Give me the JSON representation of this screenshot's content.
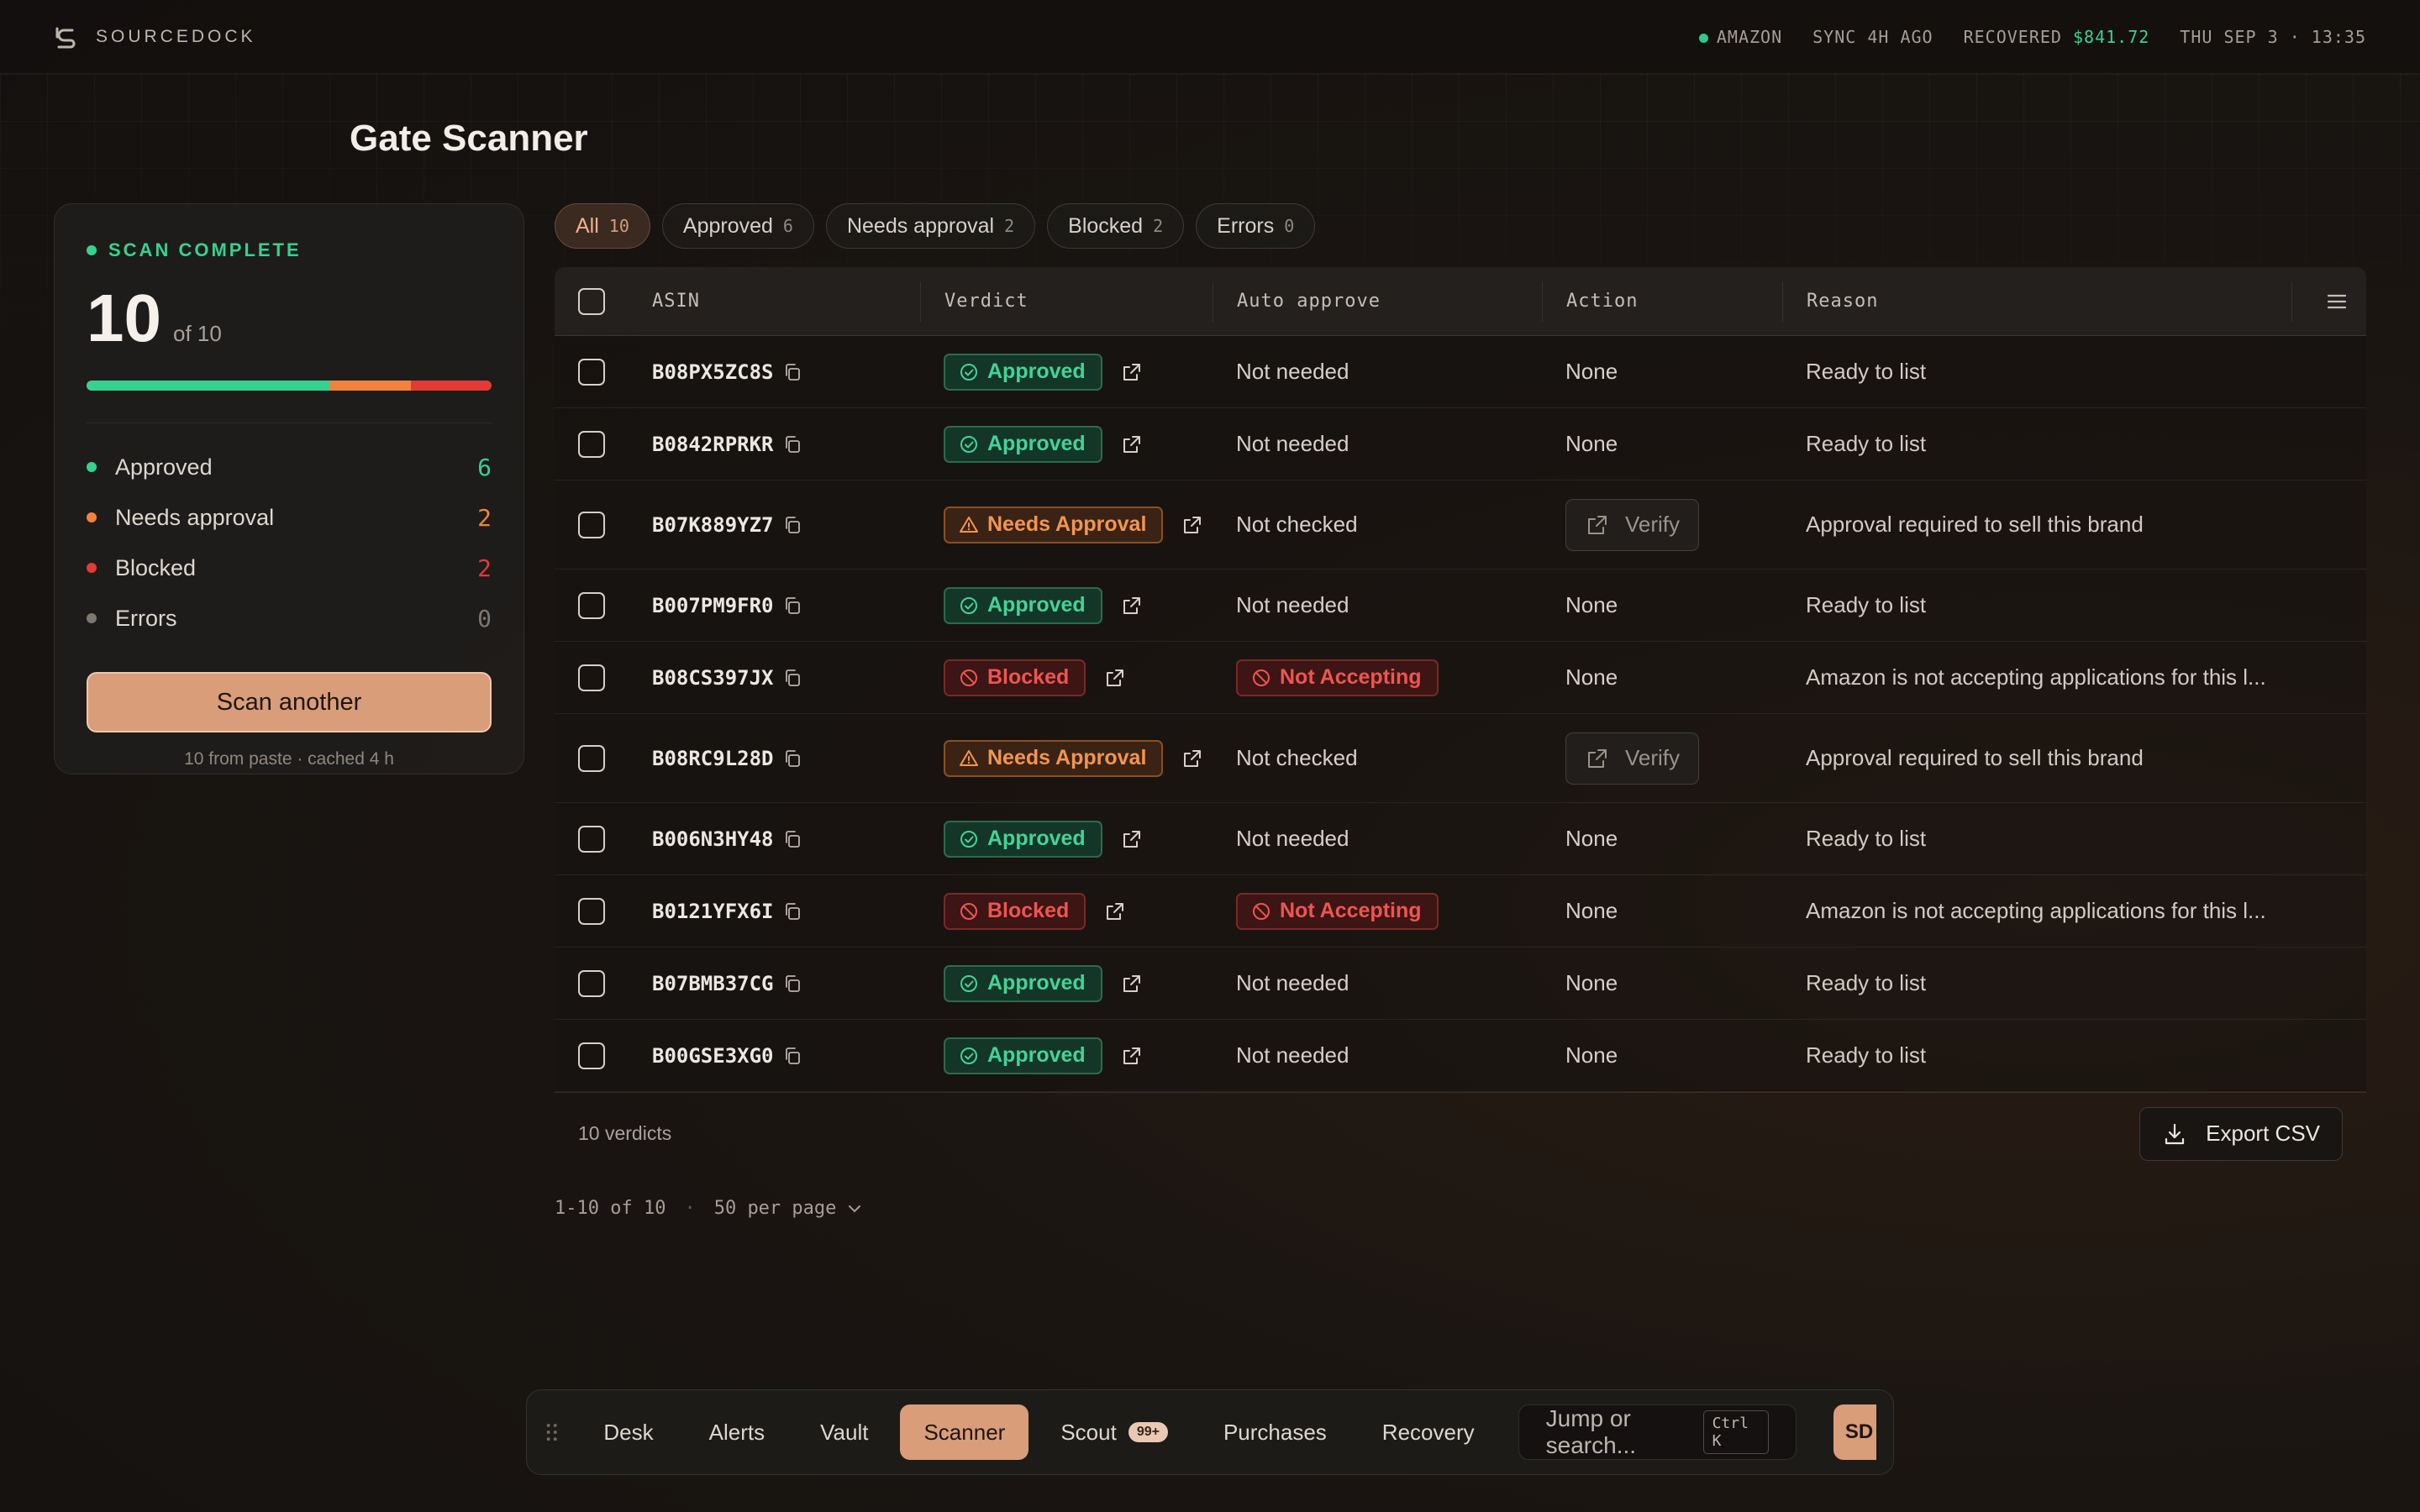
{
  "header": {
    "brand": "SOURCEDOCK",
    "marketplace": "AMAZON",
    "sync": "SYNC 4H AGO",
    "recovered_label": "RECOVERED",
    "recovered_value": "$841.72",
    "datetime": "THU SEP 3 · 13:35"
  },
  "page": {
    "title": "Gate Scanner"
  },
  "summary": {
    "status": "SCAN COMPLETE",
    "count": "10",
    "of_total": "of 10",
    "progress": {
      "approved": 6,
      "needs": 2,
      "blocked": 2,
      "errors": 0,
      "total": 10
    },
    "legend": [
      {
        "label": "Approved",
        "count": "6",
        "color": "#37d18f"
      },
      {
        "label": "Needs approval",
        "count": "2",
        "color": "#f2823e"
      },
      {
        "label": "Blocked",
        "count": "2",
        "color": "#e23b36"
      },
      {
        "label": "Errors",
        "count": "0",
        "color": "#7d7770"
      }
    ],
    "scan_button": "Scan another",
    "footnote": "10 from paste · cached 4 h"
  },
  "filters": [
    {
      "label": "All",
      "count": "10"
    },
    {
      "label": "Approved",
      "count": "6"
    },
    {
      "label": "Needs approval",
      "count": "2"
    },
    {
      "label": "Blocked",
      "count": "2"
    },
    {
      "label": "Errors",
      "count": "0"
    }
  ],
  "table": {
    "headers": {
      "asin": "ASIN",
      "verdict": "Verdict",
      "auto": "Auto approve",
      "action": "Action",
      "reason": "Reason"
    },
    "rows": [
      {
        "asin": "B08PX5ZC8S",
        "verdict": "Approved",
        "auto": "Not needed",
        "action": "None",
        "reason": "Ready to list"
      },
      {
        "asin": "B0842RPRKR",
        "verdict": "Approved",
        "auto": "Not needed",
        "action": "None",
        "reason": "Ready to list"
      },
      {
        "asin": "B07K889YZ7",
        "verdict": "Needs Approval",
        "auto": "Not checked",
        "action": "Verify",
        "reason": "Approval required to sell this brand"
      },
      {
        "asin": "B007PM9FR0",
        "verdict": "Approved",
        "auto": "Not needed",
        "action": "None",
        "reason": "Ready to list"
      },
      {
        "asin": "B08CS397JX",
        "verdict": "Blocked",
        "auto": "Not Accepting",
        "action": "None",
        "reason": "Amazon is not accepting applications for this l..."
      },
      {
        "asin": "B08RC9L28D",
        "verdict": "Needs Approval",
        "auto": "Not checked",
        "action": "Verify",
        "reason": "Approval required to sell this brand"
      },
      {
        "asin": "B006N3HY48",
        "verdict": "Approved",
        "auto": "Not needed",
        "action": "None",
        "reason": "Ready to list"
      },
      {
        "asin": "B0121YFX6I",
        "verdict": "Blocked",
        "auto": "Not Accepting",
        "action": "None",
        "reason": "Amazon is not accepting applications for this l..."
      },
      {
        "asin": "B07BMB37CG",
        "verdict": "Approved",
        "auto": "Not needed",
        "action": "None",
        "reason": "Ready to list"
      },
      {
        "asin": "B00GSE3XG0",
        "verdict": "Approved",
        "auto": "Not needed",
        "action": "None",
        "reason": "Ready to list"
      }
    ],
    "footer_count": "10 verdicts",
    "export_label": "Export CSV"
  },
  "pager": {
    "range": "1-10 of 10",
    "per_page": "50 per page"
  },
  "dock": {
    "items": [
      {
        "label": "Desk"
      },
      {
        "label": "Alerts"
      },
      {
        "label": "Vault"
      },
      {
        "label": "Scanner",
        "active": true
      },
      {
        "label": "Scout",
        "badge": "99+"
      },
      {
        "label": "Purchases"
      },
      {
        "label": "Recovery"
      }
    ],
    "search_placeholder": "Jump or search...",
    "shortcut": "Ctrl K",
    "avatar": "SD"
  }
}
